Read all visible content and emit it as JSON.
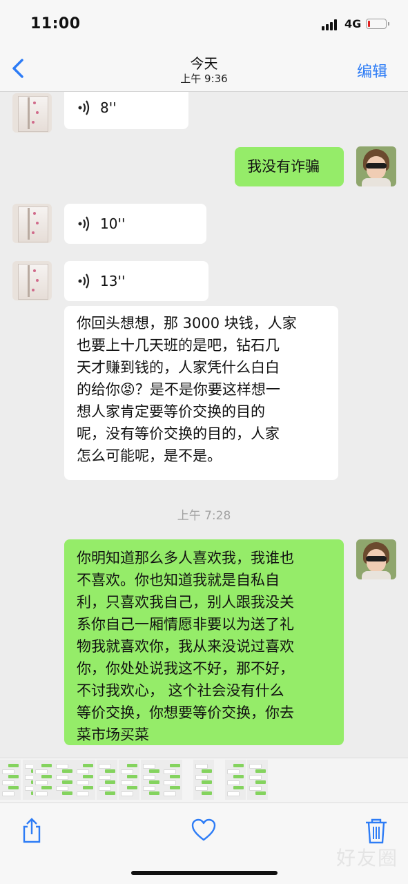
{
  "status_bar": {
    "time": "11:00",
    "network": "4G",
    "battery_level": 0.12,
    "battery_color": "#e02020"
  },
  "nav": {
    "back_icon": "chevron-left-icon",
    "title": "今天",
    "subtitle": "上午 9:36",
    "edit_label": "编辑"
  },
  "colors": {
    "accent": "#2d7cf6",
    "green_bubble": "#95ec69",
    "white_bubble": "#ffffff"
  },
  "messages": [
    {
      "type": "voice",
      "side": "left",
      "duration": "8''"
    },
    {
      "type": "text",
      "side": "right",
      "lines": [
        "我没有诈骗"
      ]
    },
    {
      "type": "voice",
      "side": "left",
      "duration": "10''"
    },
    {
      "type": "voice",
      "side": "left",
      "duration": "13''"
    },
    {
      "type": "text",
      "side": "left",
      "lines": [
        "你回头想想，那 3000 块钱，人家",
        "也要上十几天班的是吧，钻石几",
        "天才赚到钱的，人家凭什么白白",
        "的给你😡？是不是你要这样想一",
        "想人家肯定要等价交换的目的",
        "呢，没有等价交换的目的，人家",
        "怎么可能呢，是不是。"
      ]
    },
    {
      "type": "time",
      "text": "上午 7:28"
    },
    {
      "type": "text",
      "side": "right",
      "lines": [
        "你明知道那么多人喜欢我，我谁也",
        "不喜欢。你也知道我就是自私自",
        "利，只喜欢我自己，别人跟我没关",
        "系你自己一厢情愿非要以为送了礼",
        "物我就喜欢你，我从来没说过喜欢",
        "你，你处处说我这不好，那不好，",
        "不讨我欢心， 这个社会没有什么",
        "等价交换，你想要等价交换，你去",
        "菜市场买菜"
      ]
    }
  ],
  "toolbar": {
    "share_icon": "share-icon",
    "favorite_icon": "heart-icon",
    "delete_icon": "trash-icon"
  },
  "watermark": "好友圈"
}
